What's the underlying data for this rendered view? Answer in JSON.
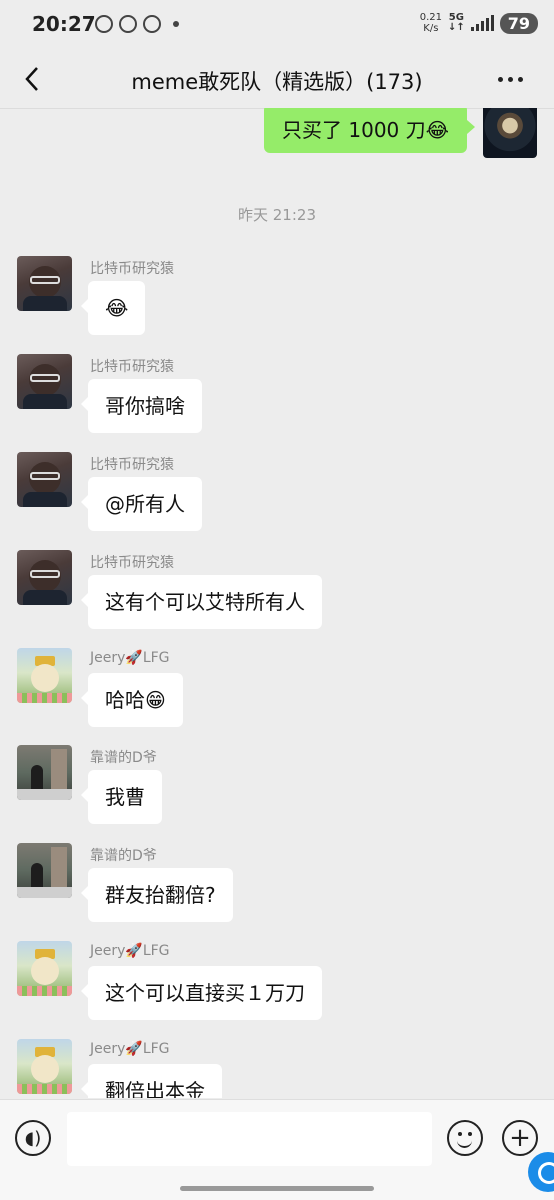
{
  "status_bar": {
    "time": "20:27",
    "speed_value": "0.21",
    "speed_unit": "K/s",
    "network": "5G",
    "battery": "79"
  },
  "header": {
    "title": "meme敢死队（精选版）(173)"
  },
  "self_message": {
    "text": "只买了 1000 刀😂"
  },
  "time_divider": "昨天 21:23",
  "messages": [
    {
      "sender": "比特币研究猿",
      "text": "😂",
      "avatar": "ape"
    },
    {
      "sender": "比特币研究猿",
      "text": "哥你搞啥",
      "avatar": "ape"
    },
    {
      "sender": "比特币研究猿",
      "text": "@所有人",
      "avatar": "ape"
    },
    {
      "sender": "比特币研究猿",
      "text": "这有个可以艾特所有人",
      "avatar": "ape"
    },
    {
      "sender": "Jeery🚀LFG",
      "text": "哈哈😁",
      "avatar": "jeery"
    },
    {
      "sender": "靠谱的D爷",
      "text": "我曹",
      "avatar": "d"
    },
    {
      "sender": "靠谱的D爷",
      "text": "群友抬翻倍?",
      "avatar": "d"
    },
    {
      "sender": "Jeery🚀LFG",
      "text": "这个可以直接买１万刀",
      "avatar": "jeery"
    },
    {
      "sender": "Jeery🚀LFG",
      "text": "翻倍出本金",
      "avatar": "jeery"
    }
  ],
  "input_bar": {
    "placeholder": ""
  },
  "colors": {
    "background": "#ededed",
    "self_bubble": "#95ec69",
    "other_bubble": "#ffffff"
  }
}
